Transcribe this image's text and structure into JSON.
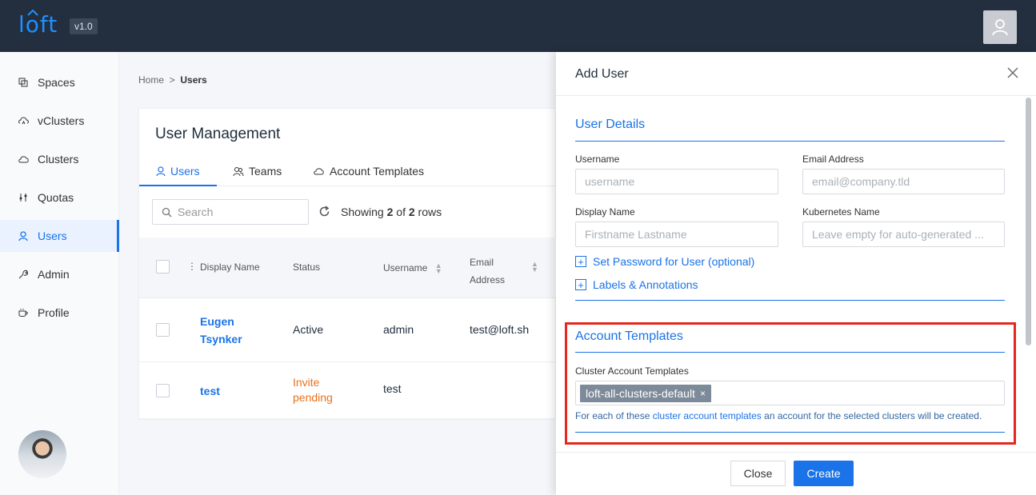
{
  "app": {
    "logo": "lofit",
    "version": "v1.0"
  },
  "sidebar": {
    "items": [
      {
        "label": "Spaces",
        "icon": "spaces-icon"
      },
      {
        "label": "vClusters",
        "icon": "vcluster-icon"
      },
      {
        "label": "Clusters",
        "icon": "cloud-icon"
      },
      {
        "label": "Quotas",
        "icon": "sliders-icon"
      },
      {
        "label": "Users",
        "icon": "user-icon",
        "active": true
      },
      {
        "label": "Admin",
        "icon": "wrench-icon"
      },
      {
        "label": "Profile",
        "icon": "coffee-icon"
      }
    ]
  },
  "breadcrumb": {
    "home": "Home",
    "separator": ">",
    "current": "Users"
  },
  "user_management": {
    "title": "User Management",
    "tabs": [
      {
        "label": "Users",
        "icon": "user-icon",
        "active": true
      },
      {
        "label": "Teams",
        "icon": "team-icon"
      },
      {
        "label": "Account Templates",
        "icon": "cloud-icon"
      }
    ],
    "search_placeholder": "Search",
    "showing_prefix": "Showing",
    "showing_count": "2",
    "showing_of": "of",
    "showing_total": "2",
    "showing_suffix": "rows",
    "columns": [
      "Display Name",
      "Status",
      "Username",
      "Email Address"
    ],
    "email_header_line1": "Email",
    "email_header_line2": "Address",
    "rows": [
      {
        "name_line1": "Eugen",
        "name_line2": "Tsynker",
        "status": "Active",
        "username": "admin",
        "email": "test@loft.sh"
      },
      {
        "name_line1": "test",
        "name_line2": "",
        "status_line1": "Invite",
        "status_line2": "pending",
        "username": "test",
        "email": ""
      }
    ]
  },
  "drawer": {
    "title": "Add User",
    "user_details": {
      "title": "User Details",
      "username_label": "Username",
      "username_placeholder": "username",
      "email_label": "Email Address",
      "email_placeholder": "email@company.tld",
      "display_name_label": "Display Name",
      "display_name_placeholder": "Firstname Lastname",
      "kube_name_label": "Kubernetes Name",
      "kube_name_placeholder": "Leave empty for auto-generated ...",
      "set_password_link": "Set Password for User (optional)",
      "labels_link": "Labels & Annotations"
    },
    "account_templates": {
      "title": "Account Templates",
      "label": "Cluster Account Templates",
      "selected_tag": "loft-all-clusters-default",
      "help_prefix": "For each of these",
      "help_link": "cluster account templates",
      "help_suffix": "an account for the selected clusters will be created."
    },
    "close_button": "Close",
    "create_button": "Create"
  },
  "colors": {
    "accent": "#1a73e8",
    "topbar": "#232f3e",
    "highlight": "#e5271d",
    "warning": "#e8711a"
  }
}
